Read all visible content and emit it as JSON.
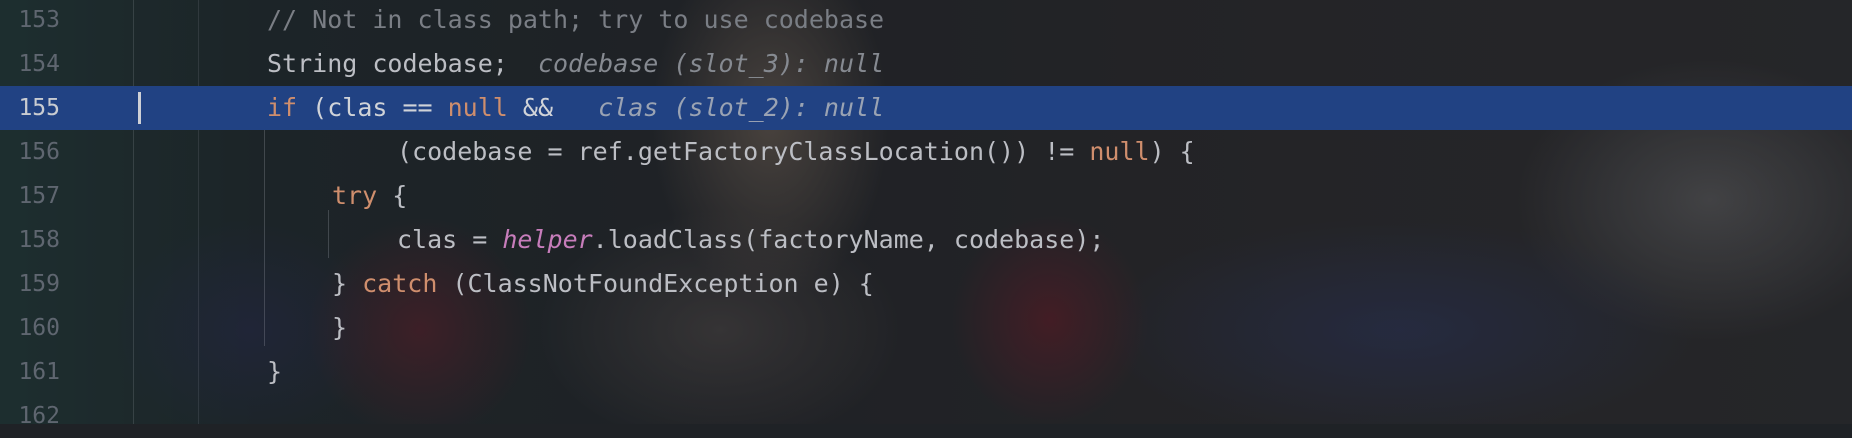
{
  "editor": {
    "colors": {
      "current_line_bg": "#214283",
      "keyword": "#cf8e6d",
      "comment": "#7a7e85",
      "field_italic": "#c77dbb",
      "default_text": "#bcbec4",
      "line_number": "#5f6670"
    },
    "lines": [
      {
        "number": "153",
        "tokens": [
          {
            "t": "// Not in class path; try to use codebase",
            "c": "comment"
          }
        ]
      },
      {
        "number": "154",
        "tokens": [
          {
            "t": "String codebase;",
            "c": ""
          },
          {
            "t": "  ",
            "c": ""
          },
          {
            "t": "codebase (slot_3): null",
            "c": "hint"
          }
        ]
      },
      {
        "number": "155",
        "tokens": [
          {
            "t": "if",
            "c": "kw"
          },
          {
            "t": " (clas == ",
            "c": ""
          },
          {
            "t": "null",
            "c": "kw"
          },
          {
            "t": " &&",
            "c": ""
          },
          {
            "t": "   ",
            "c": ""
          },
          {
            "t": "clas (slot_2): null",
            "c": "hint"
          }
        ]
      },
      {
        "number": "156",
        "tokens": [
          {
            "t": "(codebase = ref.getFactoryClassLocation()) != ",
            "c": ""
          },
          {
            "t": "null",
            "c": "kw"
          },
          {
            "t": ") {",
            "c": ""
          }
        ]
      },
      {
        "number": "157",
        "tokens": [
          {
            "t": "try",
            "c": "kw"
          },
          {
            "t": " {",
            "c": ""
          }
        ]
      },
      {
        "number": "158",
        "tokens": [
          {
            "t": "clas = ",
            "c": ""
          },
          {
            "t": "helper",
            "c": "fld"
          },
          {
            "t": ".loadClass(factoryName, codebase);",
            "c": ""
          }
        ]
      },
      {
        "number": "159",
        "tokens": [
          {
            "t": "} ",
            "c": ""
          },
          {
            "t": "catch",
            "c": "kw"
          },
          {
            "t": " (ClassNotFoundException e) {",
            "c": ""
          }
        ]
      },
      {
        "number": "160",
        "tokens": [
          {
            "t": "}",
            "c": ""
          }
        ]
      },
      {
        "number": "161",
        "tokens": [
          {
            "t": "}",
            "c": ""
          }
        ]
      },
      {
        "number": "162",
        "tokens": []
      }
    ]
  }
}
